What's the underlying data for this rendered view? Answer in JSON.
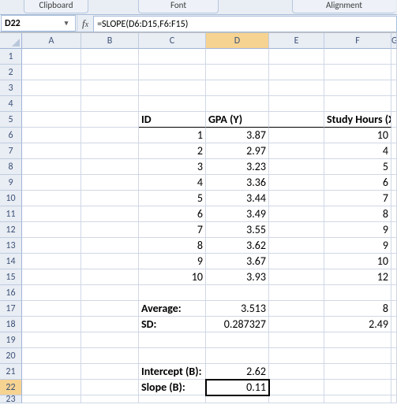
{
  "ribbon": {
    "groups": {
      "clipboard": "Clipboard",
      "font": "Font",
      "alignment": "Alignment"
    }
  },
  "namebox": "D22",
  "formula": "=SLOPE(D6:D15,F6:F15)",
  "col_headers": [
    "A",
    "B",
    "C",
    "D",
    "E",
    "F"
  ],
  "last_col_fragment": "G",
  "rows_shown": 22,
  "partial_row": "23",
  "headers": {
    "id": "ID",
    "y": "GPA (Y)",
    "x": "Study Hours (X)"
  },
  "rows": [
    {
      "id": "1",
      "y": "3.87",
      "x": "10"
    },
    {
      "id": "2",
      "y": "2.97",
      "x": "4"
    },
    {
      "id": "3",
      "y": "3.23",
      "x": "5"
    },
    {
      "id": "4",
      "y": "3.36",
      "x": "6"
    },
    {
      "id": "5",
      "y": "3.44",
      "x": "7"
    },
    {
      "id": "6",
      "y": "3.49",
      "x": "8"
    },
    {
      "id": "7",
      "y": "3.55",
      "x": "9"
    },
    {
      "id": "8",
      "y": "3.62",
      "x": "9"
    },
    {
      "id": "9",
      "y": "3.67",
      "x": "10"
    },
    {
      "id": "10",
      "y": "3.93",
      "x": "12"
    }
  ],
  "labels": {
    "average": "Average:",
    "sd": "SD:",
    "intercept": "Intercept (B):",
    "slope": "Slope (B):"
  },
  "stats": {
    "avg_y": "3.513",
    "avg_x": "8",
    "sd_y": "0.287327",
    "sd_x": "2.49",
    "intercept": "2.62",
    "slope": "0.11"
  },
  "active_cell": "D22",
  "chart_data": {
    "type": "table",
    "series": [
      {
        "name": "GPA (Y)",
        "values": [
          3.87,
          2.97,
          3.23,
          3.36,
          3.44,
          3.49,
          3.55,
          3.62,
          3.67,
          3.93
        ]
      },
      {
        "name": "Study Hours (X)",
        "values": [
          10,
          4,
          5,
          6,
          7,
          8,
          9,
          9,
          10,
          12
        ]
      }
    ],
    "summary": {
      "Average": {
        "Y": 3.513,
        "X": 8
      },
      "SD": {
        "Y": 0.287327,
        "X": 2.49
      },
      "Intercept": 2.62,
      "Slope": 0.11
    }
  }
}
